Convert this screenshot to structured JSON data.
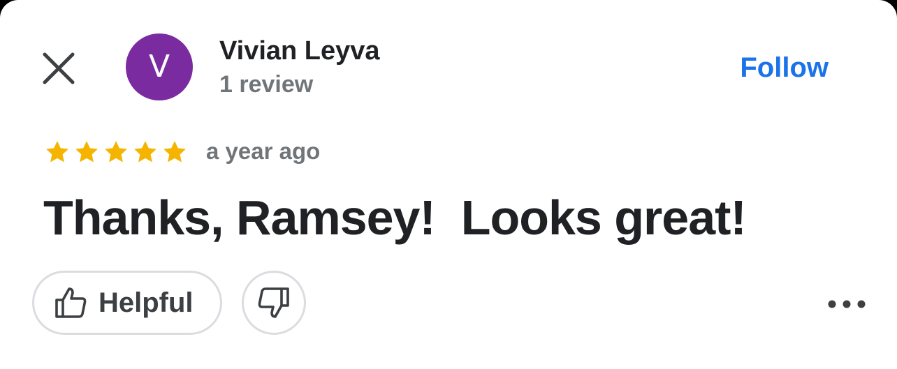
{
  "reviewer": {
    "initial": "V",
    "name": "Vivian Leyva",
    "review_count": "1 review",
    "avatar_color": "#7b2ba0"
  },
  "header": {
    "close_icon": "close-icon",
    "follow_label": "Follow",
    "follow_color": "#1a73e8"
  },
  "review": {
    "rating": 5,
    "max_rating": 5,
    "star_color": "#f4b400",
    "time": "a year ago",
    "text": "Thanks, Ramsey!  Looks great!"
  },
  "actions": {
    "helpful_label": "Helpful",
    "helpful_icon": "thumb-up-icon",
    "not_helpful_icon": "thumb-down-icon",
    "more_icon": "more-horizontal-icon"
  }
}
